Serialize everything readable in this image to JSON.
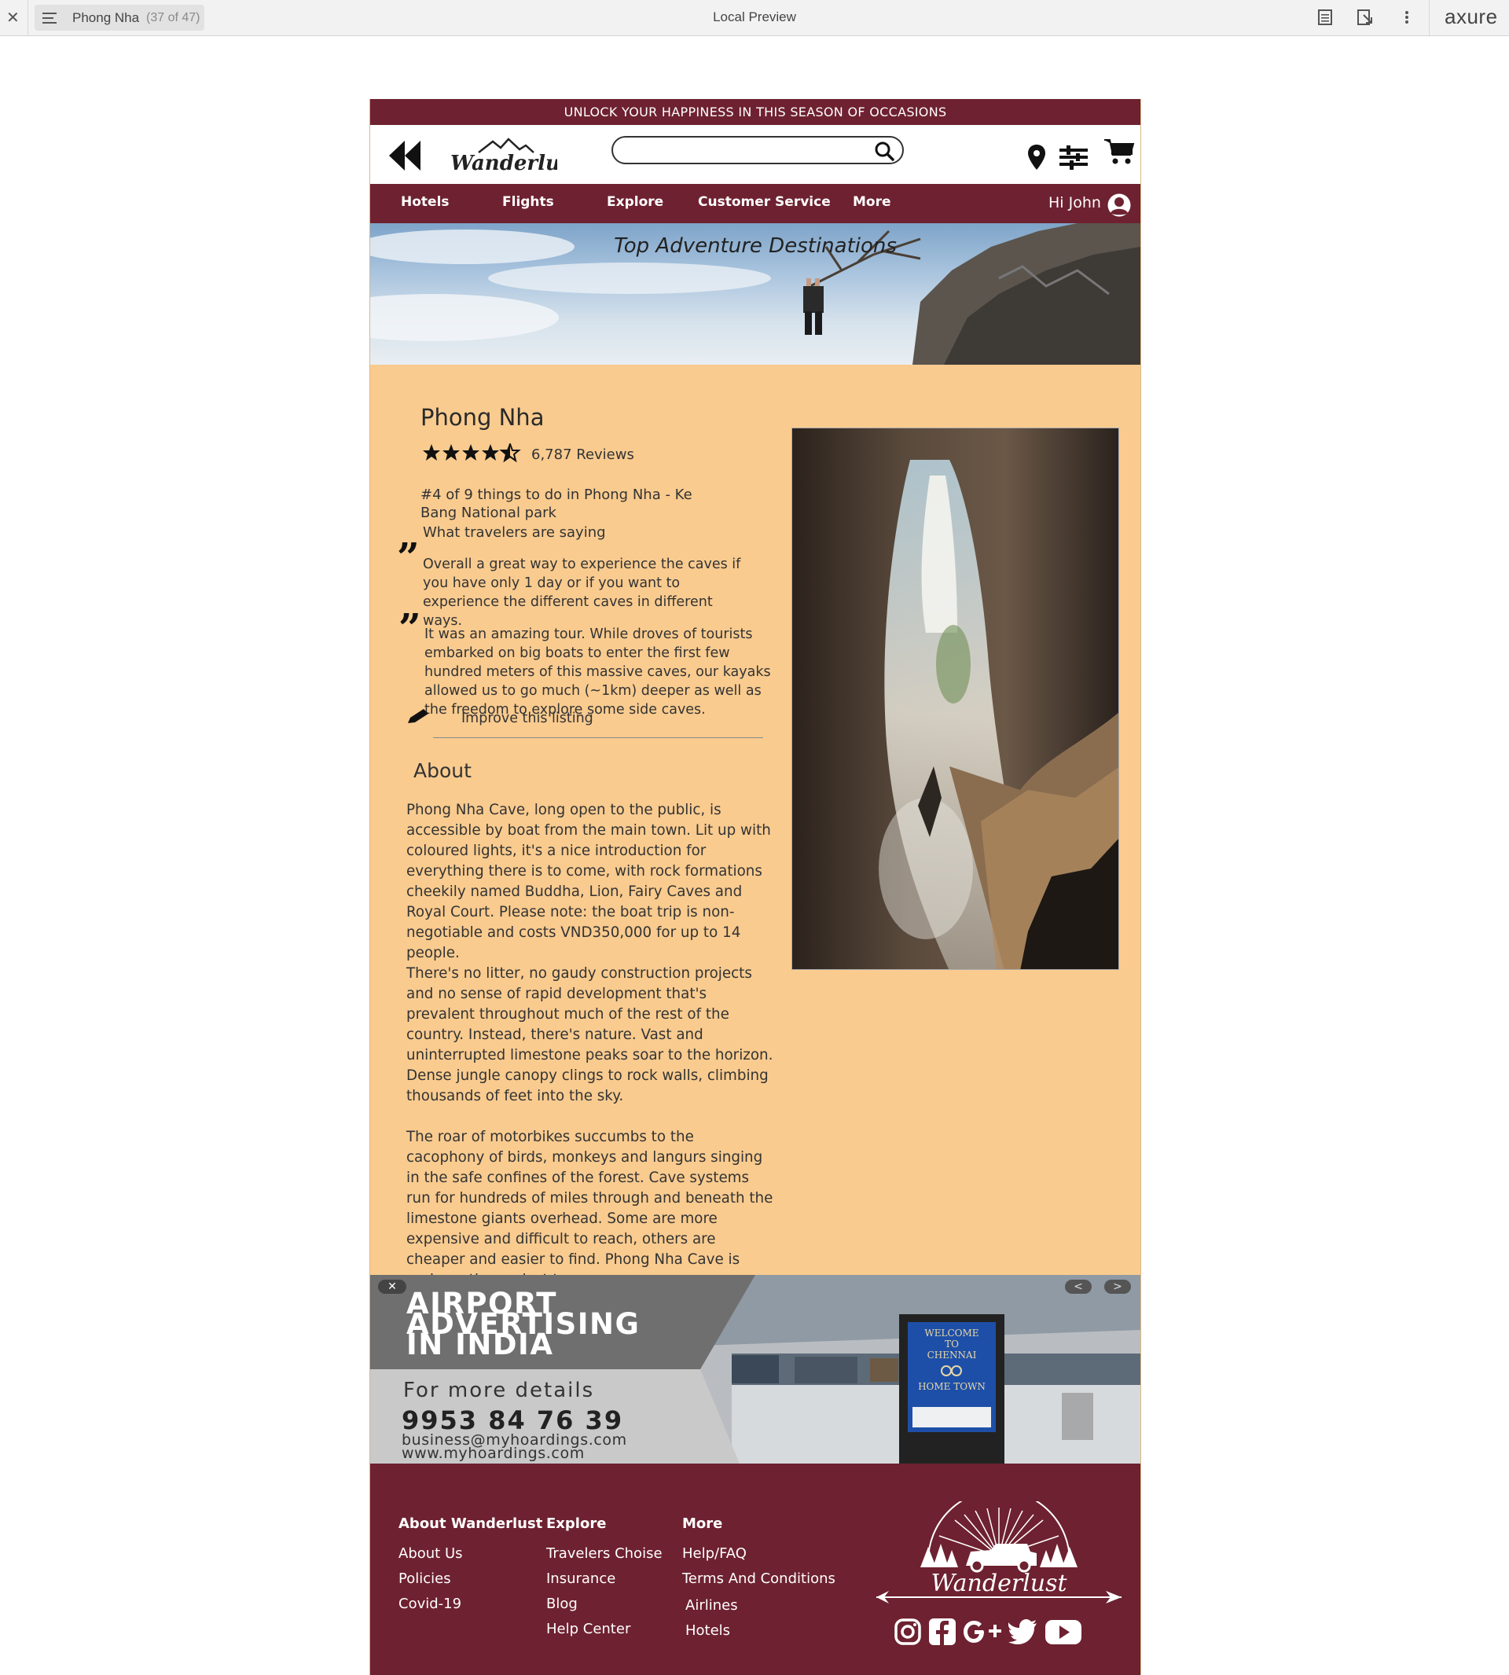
{
  "chrome": {
    "page_name": "Phong Nha",
    "page_count": "(37 of 47)",
    "window_title": "Local Preview",
    "brand": "axure"
  },
  "promo": {
    "text": "UNLOCK YOUR HAPPINESS IN THIS SEASON OF OCCASIONS"
  },
  "header": {
    "logo_text": "Wanderlust",
    "search_value": "",
    "search_placeholder": ""
  },
  "nav": {
    "items": [
      "Hotels",
      "Flights",
      "Explore",
      "Customer Service",
      "More"
    ],
    "greeting": "Hi John"
  },
  "hero": {
    "title": "Top Adventure Destinations"
  },
  "listing": {
    "title": "Phong Nha",
    "rating": 4.5,
    "reviews": "6,787 Reviews",
    "rank": "#4 of 9 things to do in Phong Nha - Ke Bang National park",
    "saying_label": "What travelers are saying",
    "quotes": [
      "Overall a great way to experience the caves if you have only 1 day or if you want to experience the different caves in different ways.",
      "It was an amazing tour. While droves of tourists embarked on big boats to enter the first few hundred meters of this massive caves, our kayaks allowed us to go much (~1km) deeper as well as the freedom to explore some side caves."
    ],
    "improve_link": "Improve this listing"
  },
  "about": {
    "heading": "About",
    "paragraphs": [
      "Phong Nha Cave, long open to the public, is accessible by boat from the main town. Lit up with coloured lights, it's a nice introduction for everything there is to come, with rock formations cheekily named Buddha, Lion, Fairy Caves and Royal Court. Please note: the boat trip is non-negotiable and costs VND350,000 for up to 14 people.",
      "There's no litter, no gaudy construction projects and no sense of rapid development that's prevalent throughout much of the rest of the country. Instead, there's nature. Vast and uninterrupted limestone peaks soar to the horizon. Dense jungle canopy clings to rock walls, climbing thousands of feet into the sky.",
      "The roar of motorbikes succumbs to the cacophony of birds, monkeys and langurs singing in the safe confines of the forest. Cave systems run for hundreds of miles through and beneath the limestone giants overhead. Some are more expensive and difficult to reach, others are cheaper and easier to find. Phong Nha Cave is perhaps the easiest to"
    ]
  },
  "ad": {
    "headline": [
      "AIRPORT",
      "ADVERTISING",
      "IN INDIA"
    ],
    "more_details": "For more details",
    "phone": "9953 84 76 39",
    "email": "business@myhoardings.com",
    "website": "www.myhoardings.com",
    "sign_text": [
      "WELCOME",
      "TO",
      "CHENNAI",
      "HOME TOWN"
    ],
    "close": "✕",
    "prev": "<",
    "next": ">"
  },
  "footer": {
    "columns": [
      {
        "heading": "About Wanderlust",
        "links": [
          "About Us",
          "Policies",
          "Covid-19"
        ]
      },
      {
        "heading": "Explore",
        "links": [
          "Travelers Choise",
          "Insurance",
          "Blog",
          "Help Center"
        ]
      },
      {
        "heading": "More",
        "links": [
          "Help/FAQ",
          "Terms And Conditions",
          "Airlines",
          "Hotels"
        ]
      }
    ],
    "logo_text": "Wanderlust",
    "social_icons": [
      "instagram-icon",
      "facebook-icon",
      "google-plus-icon",
      "twitter-icon",
      "youtube-icon"
    ]
  },
  "colors": {
    "brand_maroon": "#6e2130",
    "content_bg": "#f9cb8f"
  }
}
